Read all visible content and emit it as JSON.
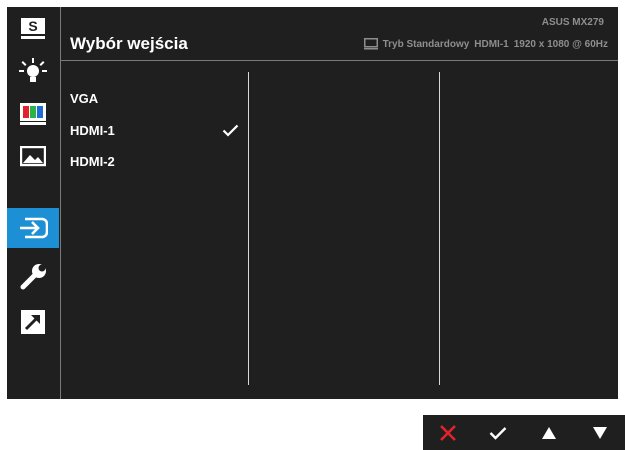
{
  "osd": {
    "model": "ASUS MX279",
    "title": "Wybór wejścia",
    "status": {
      "mode": "Tryb Standardowy",
      "input": "HDMI-1",
      "resolution": "1920 x 1080 @ 60Hz"
    },
    "sidebar": [
      {
        "icon": "splendid-s-icon",
        "active": false
      },
      {
        "icon": "brightness-icon",
        "active": false
      },
      {
        "icon": "color-icon",
        "active": false
      },
      {
        "icon": "image-icon",
        "active": false
      },
      {
        "icon": "input-select-icon",
        "active": true
      },
      {
        "icon": "system-setup-icon",
        "active": false
      },
      {
        "icon": "shortcut-icon",
        "active": false
      }
    ],
    "options": [
      {
        "label": "VGA",
        "selected": false
      },
      {
        "label": "HDMI-1",
        "selected": true
      },
      {
        "label": "HDMI-2",
        "selected": false
      }
    ],
    "sidebar_letter": "S"
  },
  "buttons": [
    {
      "icon": "close-icon"
    },
    {
      "icon": "confirm-check-icon"
    },
    {
      "icon": "up-arrow-icon"
    },
    {
      "icon": "down-arrow-icon"
    }
  ],
  "colors": {
    "background": "#1f1f1f",
    "active": "#1d8fd4",
    "close": "#e0242b",
    "text": "#ffffff",
    "muted": "#8e8e8e"
  }
}
